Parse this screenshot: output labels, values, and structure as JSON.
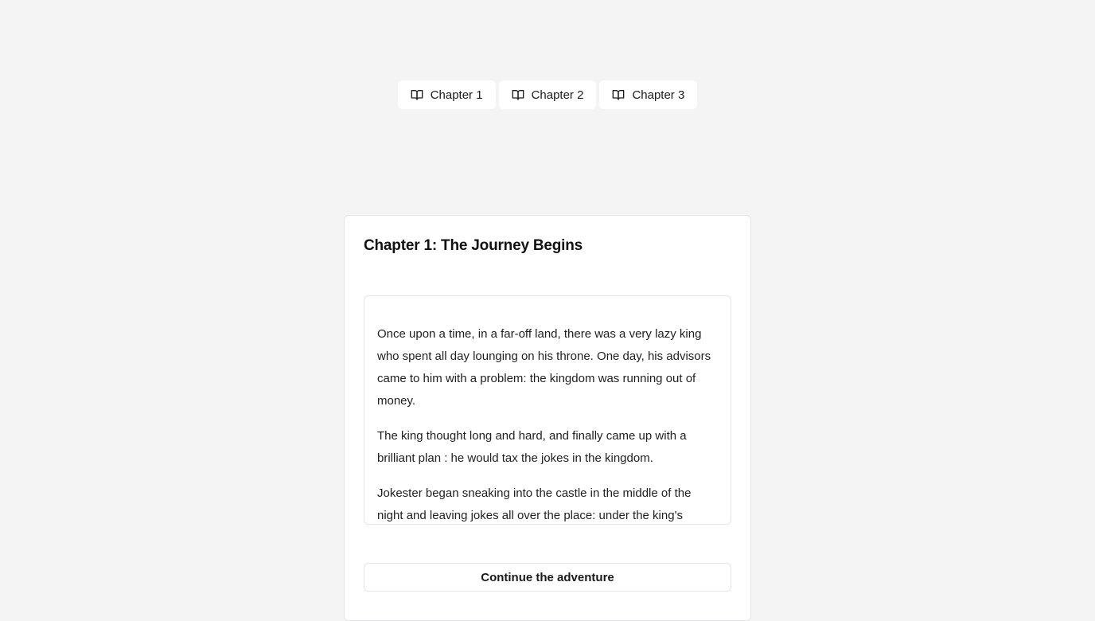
{
  "tabs": [
    {
      "label": "Chapter 1",
      "icon": "book-open-icon"
    },
    {
      "label": "Chapter 2",
      "icon": "book-open-icon"
    },
    {
      "label": "Chapter 3",
      "icon": "book-open-icon"
    }
  ],
  "card": {
    "title": "Chapter 1: The Journey Begins",
    "paragraphs": [
      "Once upon a time, in a far-off land, there was a very lazy king who spent all day lounging on his throne. One day, his advisors came to him with a problem: the kingdom was running out of money.",
      "The king thought long and hard, and finally came up with a brilliant plan : he would tax the jokes in the kingdom.",
      "Jokester began sneaking into the castle in the middle of the night and leaving jokes all over the place: under the king's pillow,"
    ],
    "continue_label": "Continue the adventure"
  },
  "colors": {
    "background": "#f4f4f4",
    "card": "#ffffff",
    "border": "#e4e4e7",
    "text": "#1a1a1a"
  }
}
